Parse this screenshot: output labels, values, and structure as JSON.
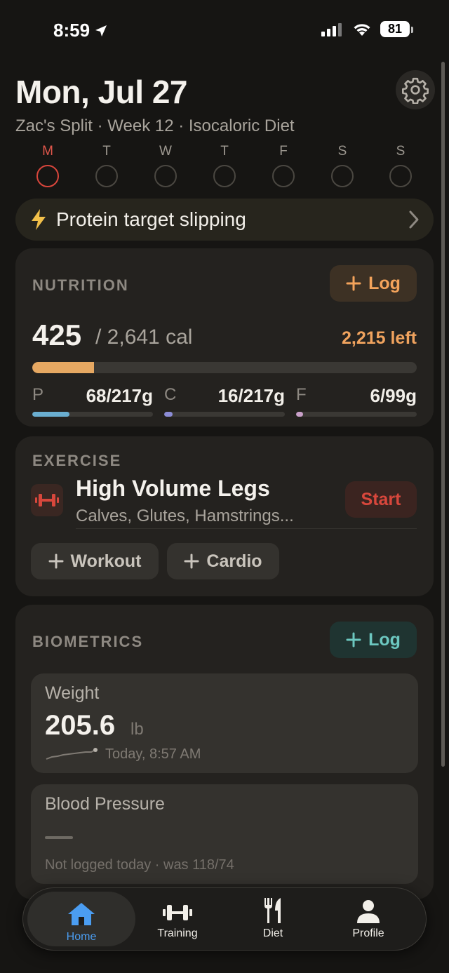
{
  "status": {
    "time": "8:59",
    "battery": "81"
  },
  "header": {
    "date": "Mon, Jul 27",
    "subtitle": "Zac's Split · Week 12 · Isocaloric Diet"
  },
  "week": {
    "days": [
      {
        "letter": "M",
        "active": true
      },
      {
        "letter": "T",
        "active": false
      },
      {
        "letter": "W",
        "active": false
      },
      {
        "letter": "T",
        "active": false
      },
      {
        "letter": "F",
        "active": false
      },
      {
        "letter": "S",
        "active": false
      },
      {
        "letter": "S",
        "active": false
      }
    ]
  },
  "alert": {
    "text": "Protein target slipping"
  },
  "nutrition": {
    "title": "NUTRITION",
    "log_label": "Log",
    "calories": "425",
    "calories_total": "/ 2,641 cal",
    "calories_left": "2,215 left",
    "calorie_fraction": 0.161,
    "macros": [
      {
        "letter": "P",
        "value": "68/217g",
        "fraction": 0.31,
        "color": "#6aaed0"
      },
      {
        "letter": "C",
        "value": "16/217g",
        "fraction": 0.07,
        "color": "#8c8cd6"
      },
      {
        "letter": "F",
        "value": "6/99g",
        "fraction": 0.06,
        "color": "#c9a0c9"
      }
    ]
  },
  "exercise": {
    "title": "EXERCISE",
    "workout_name": "High Volume Legs",
    "muscles": "Calves, Glutes, Hamstrings...",
    "start_label": "Start",
    "add_workout": "Workout",
    "add_cardio": "Cardio"
  },
  "biometrics": {
    "title": "BIOMETRICS",
    "log_label": "Log",
    "weight": {
      "label": "Weight",
      "value": "205.6",
      "unit": "lb",
      "time": "Today, 8:57 AM"
    },
    "blood_pressure": {
      "label": "Blood Pressure",
      "note": "Not logged today · was 118/74"
    }
  },
  "tabs": [
    {
      "label": "Home",
      "icon": "home-icon",
      "active": true
    },
    {
      "label": "Training",
      "icon": "dumbbell-icon",
      "active": false
    },
    {
      "label": "Diet",
      "icon": "fork-knife-icon",
      "active": false
    },
    {
      "label": "Profile",
      "icon": "person-icon",
      "active": false
    }
  ],
  "colors": {
    "accent_orange": "#f3a35b",
    "accent_teal": "#6cc7c0",
    "accent_red": "#d8473c",
    "tab_active": "#4b9df1"
  }
}
